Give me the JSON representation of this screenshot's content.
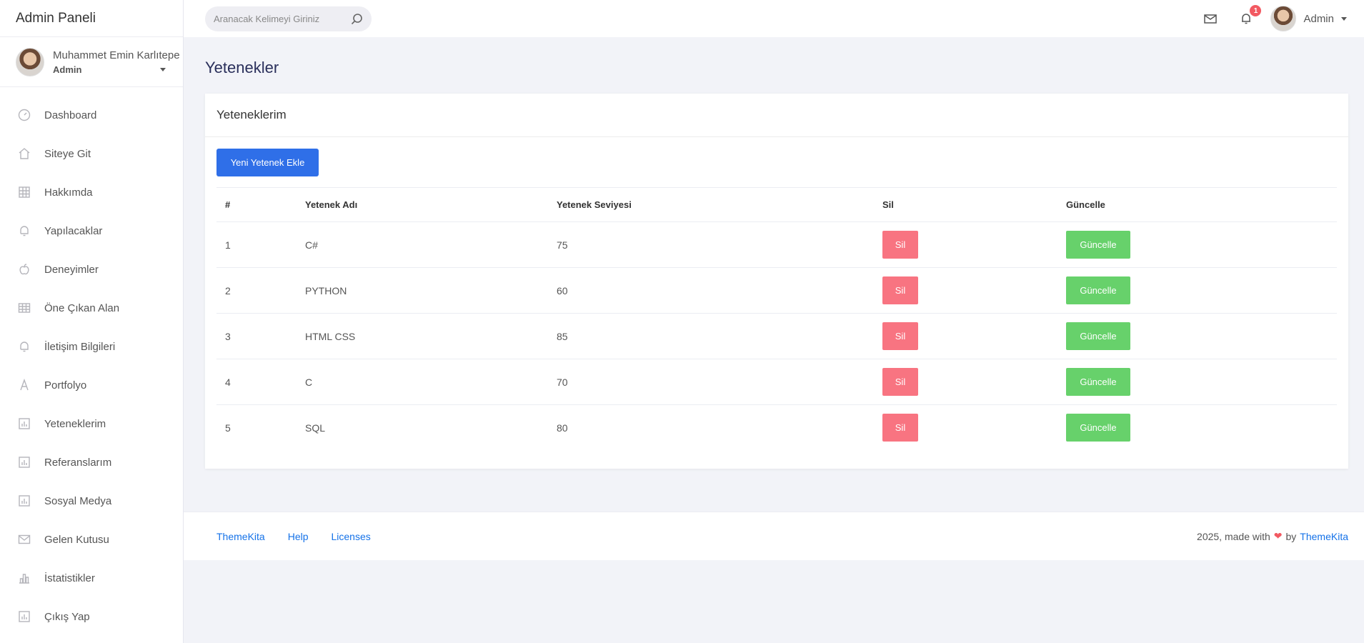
{
  "app": {
    "title": "Admin Paneli"
  },
  "user": {
    "name": "Muhammet Emin Karlıtepe",
    "role": "Admin"
  },
  "sidebar": {
    "items": [
      {
        "label": "Dashboard",
        "icon": "dashboard-icon"
      },
      {
        "label": "Siteye Git",
        "icon": "home-icon"
      },
      {
        "label": "Hakkımda",
        "icon": "grid-icon"
      },
      {
        "label": "Yapılacaklar",
        "icon": "bell-icon"
      },
      {
        "label": "Deneyimler",
        "icon": "apple-icon"
      },
      {
        "label": "Öne Çıkan Alan",
        "icon": "table-icon"
      },
      {
        "label": "İletişim Bilgileri",
        "icon": "bell-icon"
      },
      {
        "label": "Portfolyo",
        "icon": "font-icon"
      },
      {
        "label": "Yeteneklerim",
        "icon": "chart-square-icon"
      },
      {
        "label": "Referanslarım",
        "icon": "chart-square-icon"
      },
      {
        "label": "Sosyal Medya",
        "icon": "chart-square-icon"
      },
      {
        "label": "Gelen Kutusu",
        "icon": "envelope-icon"
      },
      {
        "label": "İstatistikler",
        "icon": "bar-chart-icon"
      },
      {
        "label": "Çıkış Yap",
        "icon": "chart-square-icon"
      }
    ]
  },
  "topbar": {
    "search_placeholder": "Aranacak Kelimeyi Giriniz",
    "notification_count": "1",
    "user_name": "Admin"
  },
  "page": {
    "title": "Yetenekler",
    "card_title": "Yeteneklerim",
    "add_button": "Yeni Yetenek Ekle"
  },
  "table": {
    "headers": [
      "#",
      "Yetenek Adı",
      "Yetenek Seviyesi",
      "Sil",
      "Güncelle"
    ],
    "rows": [
      {
        "id": "1",
        "name": "C#",
        "level": "75",
        "delete": "Sil",
        "update": "Güncelle"
      },
      {
        "id": "2",
        "name": "PYTHON",
        "level": "60",
        "delete": "Sil",
        "update": "Güncelle"
      },
      {
        "id": "3",
        "name": "HTML CSS",
        "level": "85",
        "delete": "Sil",
        "update": "Güncelle"
      },
      {
        "id": "4",
        "name": "C",
        "level": "70",
        "delete": "Sil",
        "update": "Güncelle"
      },
      {
        "id": "5",
        "name": "SQL",
        "level": "80",
        "delete": "Sil",
        "update": "Güncelle"
      }
    ]
  },
  "footer": {
    "links": [
      "ThemeKita",
      "Help",
      "Licenses"
    ],
    "copyright_prefix": "2025, made with",
    "by_text": "by",
    "brand": "ThemeKita"
  },
  "colors": {
    "primary": "#2f6fe8",
    "danger": "#f87481",
    "success": "#67d16b",
    "link": "#1572e8",
    "badge": "#f25961"
  }
}
